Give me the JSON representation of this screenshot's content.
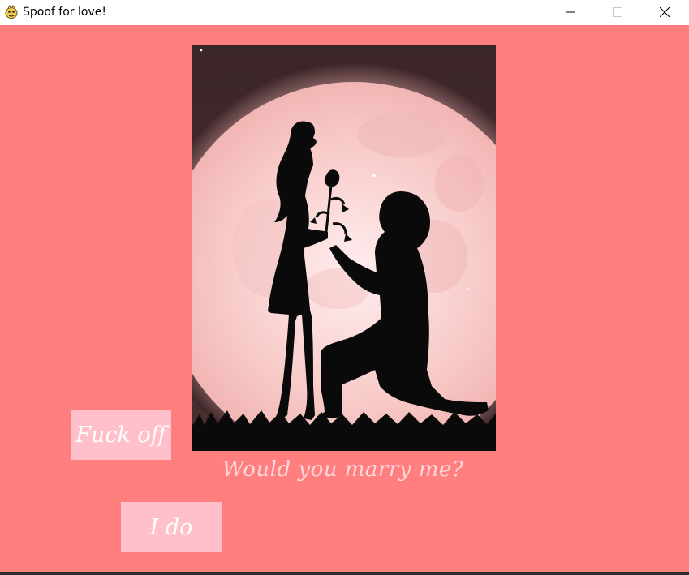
{
  "window": {
    "title": "Spoof for love!",
    "icon": "pygame-snake-icon",
    "controls": {
      "minimize": "minimize-icon",
      "maximize": "maximize-icon",
      "close": "close-icon"
    }
  },
  "colors": {
    "background": "#ff7f7f",
    "button_bg": "#ffc0cb",
    "button_text": "#ffffff",
    "question_text": "#ffd6de",
    "moon": "#f7c9c6",
    "silhouette": "#0a0a0a"
  },
  "main": {
    "image": "proposal-silhouette",
    "question": "Would you marry me?",
    "reject_label": "Fuck off",
    "accept_label": "I do"
  }
}
